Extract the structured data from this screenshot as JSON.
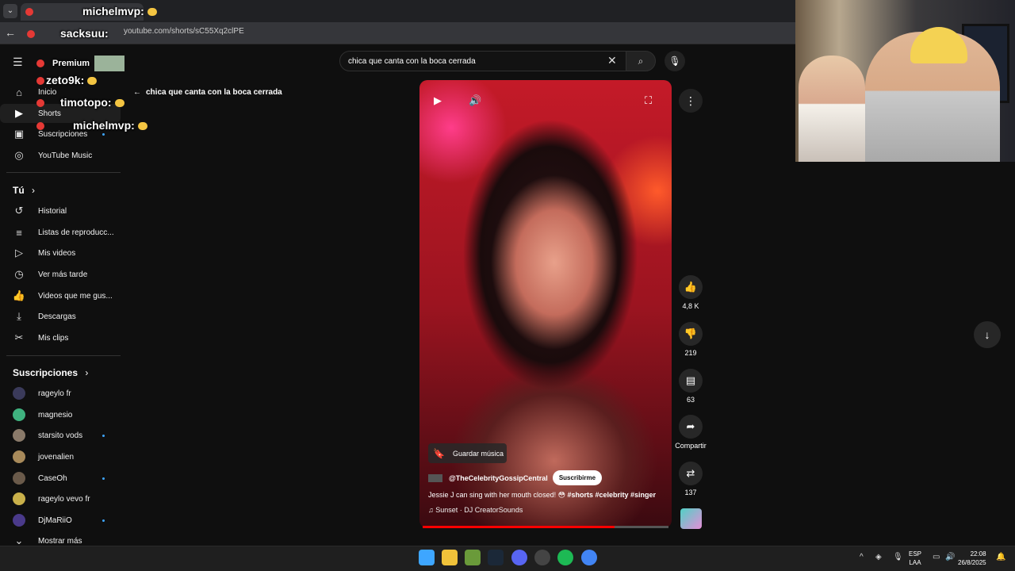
{
  "browser": {
    "url": "youtube.com/shorts/sC55Xq2clPE"
  },
  "chat": {
    "messages": [
      {
        "user": "michelmvp:",
        "top": true
      },
      {
        "user": "sacksuu:"
      },
      {
        "user": "Premium"
      },
      {
        "user": "zeto9k:"
      },
      {
        "user": "timotopo:"
      },
      {
        "user": "michelmvp:"
      }
    ]
  },
  "sidebar": {
    "main": [
      {
        "label": "Inicio",
        "icon": "home-icon"
      },
      {
        "label": "Shorts",
        "icon": "shorts-icon"
      },
      {
        "label": "Suscripciones",
        "icon": "subscriptions-icon"
      },
      {
        "label": "YouTube Music",
        "icon": "music-icon"
      }
    ],
    "you_header": "Tú",
    "you": [
      {
        "label": "Historial",
        "icon": "history-icon"
      },
      {
        "label": "Listas de reproducc...",
        "icon": "playlist-icon"
      },
      {
        "label": "Mis videos",
        "icon": "video-icon"
      },
      {
        "label": "Ver más tarde",
        "icon": "clock-icon"
      },
      {
        "label": "Videos que me gus...",
        "icon": "like-icon"
      },
      {
        "label": "Descargas",
        "icon": "download-icon"
      },
      {
        "label": "Mis clips",
        "icon": "scissors-icon"
      }
    ],
    "subs_header": "Suscripciones",
    "subs": [
      {
        "label": "rageylo fr",
        "color": "#3a3a5a",
        "dot": false
      },
      {
        "label": "magnesio",
        "color": "#3fb27f",
        "dot": false
      },
      {
        "label": "starsito vods",
        "color": "#8a7a6a",
        "dot": true
      },
      {
        "label": "jovenalien",
        "color": "#a88a5a",
        "dot": false
      },
      {
        "label": "CaseOh",
        "color": "#6a5a4a",
        "dot": true
      },
      {
        "label": "rageylo vevo fr",
        "color": "#c9b04a",
        "dot": false
      },
      {
        "label": "DjMaRiiO",
        "color": "#4a3a8a",
        "dot": true
      }
    ],
    "show_more": "Mostrar más"
  },
  "search": {
    "query": "chica que canta con la boca cerrada"
  },
  "back_query": "chica que canta con la boca cerrada",
  "short": {
    "save_music": "Guardar música",
    "channel": "@TheCelebrityGossipCentral",
    "subscribe": "Suscribirme",
    "caption_text": "Jessie J can sing with her mouth closed! 😳",
    "caption_tags": "#shorts #celebrity #singer",
    "music": "Sunset · DJ CreatorSounds",
    "progress": 0.78
  },
  "actions": {
    "likes": "4,8 K",
    "dislikes": "219",
    "comments": "63",
    "share": "Compartir",
    "remix": "137"
  },
  "taskbar": {
    "lang_line1": "ESP",
    "lang_line2": "LAA",
    "time": "22:08",
    "date": "26/8/2025"
  },
  "colors": {
    "accent": "#ff0000",
    "link": "#3ea6ff"
  }
}
